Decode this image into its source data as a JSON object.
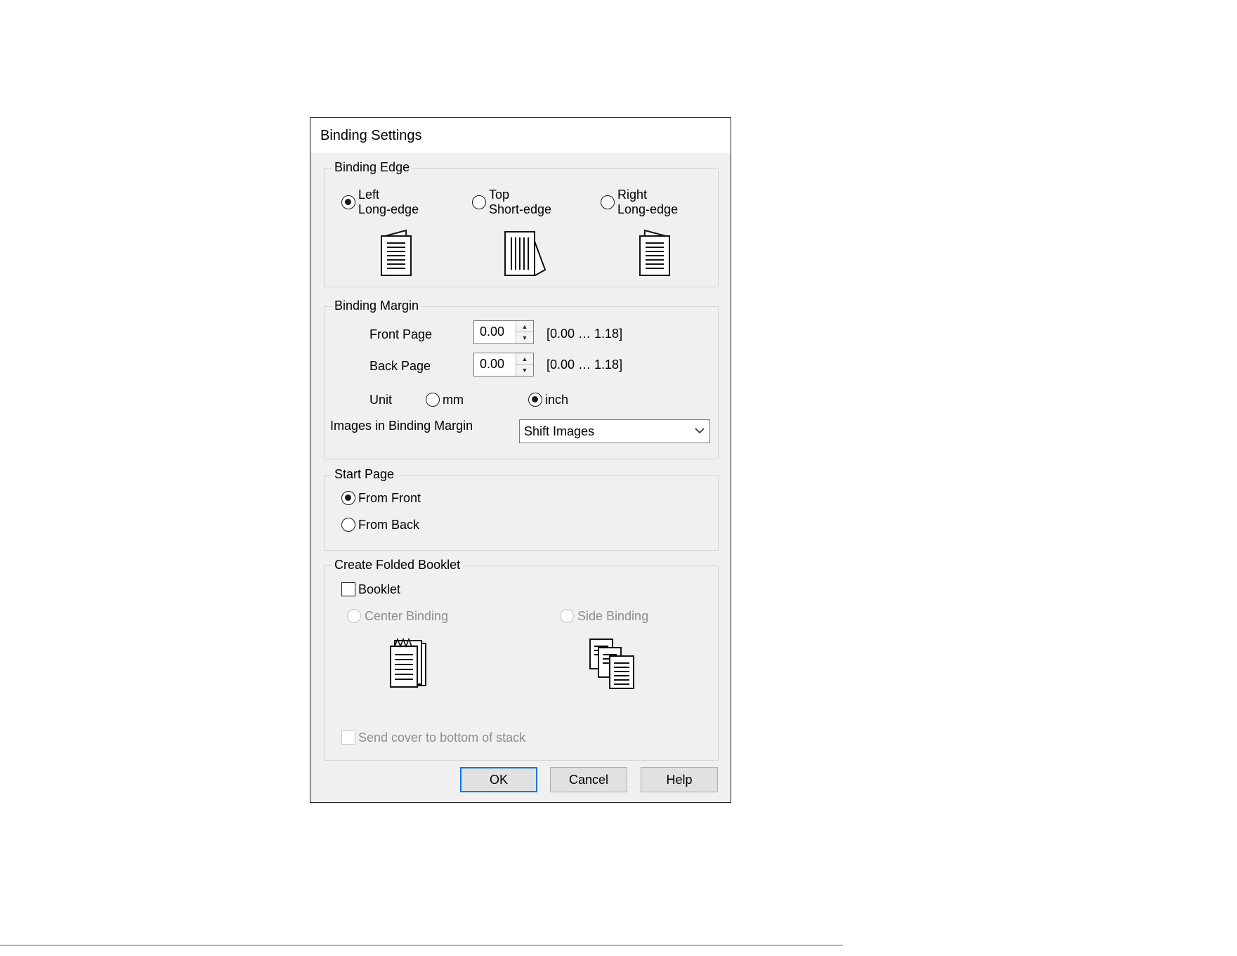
{
  "dialog": {
    "title": "Binding Settings",
    "binding_edge": {
      "legend": "Binding Edge",
      "options": [
        {
          "line1": "Left",
          "line2": "Long-edge",
          "selected": true,
          "icon": "page-left-binding-icon"
        },
        {
          "line1": "Top",
          "line2": "Short-edge",
          "selected": false,
          "icon": "page-top-binding-icon"
        },
        {
          "line1": "Right",
          "line2": "Long-edge",
          "selected": false,
          "icon": "page-right-binding-icon"
        }
      ]
    },
    "binding_margin": {
      "legend": "Binding Margin",
      "front_page_label": "Front Page",
      "front_page_value": "0.00",
      "front_page_range": "[0.00 … 1.18]",
      "back_page_label": "Back Page",
      "back_page_value": "0.00",
      "back_page_range": "[0.00 … 1.18]",
      "unit_label": "Unit",
      "unit_mm": "mm",
      "unit_inch": "inch",
      "unit_selected": "inch",
      "images_label": "Images in Binding Margin",
      "images_value": "Shift Images"
    },
    "start_page": {
      "legend": "Start Page",
      "from_front": "From Front",
      "from_back": "From Back",
      "selected": "From Front"
    },
    "folded_booklet": {
      "legend": "Create Folded Booklet",
      "booklet_label": "Booklet",
      "booklet_checked": false,
      "center_binding": "Center Binding",
      "side_binding": "Side Binding",
      "send_cover": "Send cover to bottom of stack"
    },
    "buttons": {
      "ok": "OK",
      "cancel": "Cancel",
      "help": "Help"
    }
  }
}
